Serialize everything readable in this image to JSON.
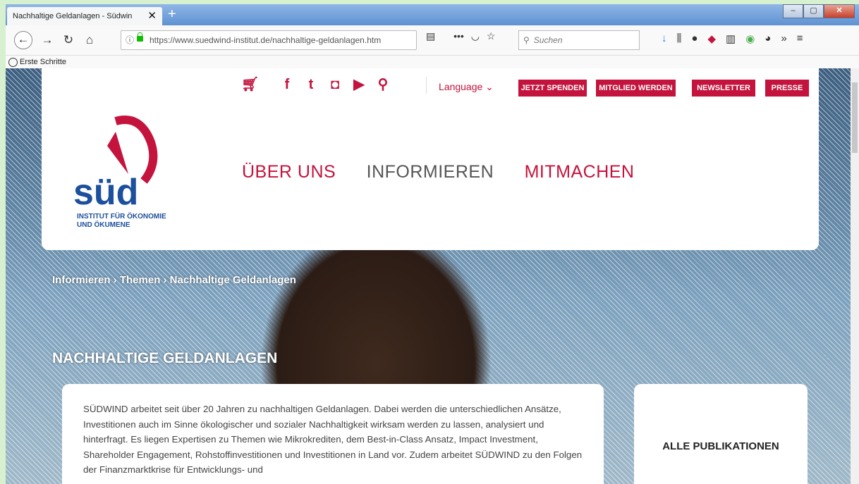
{
  "browser": {
    "tab_title": "Nachhaltige Geldanlagen - Südwin",
    "url_host": "https://www.suedwind-institut.de",
    "url_path": "/nachhaltige-geldanlagen.htm",
    "search_placeholder": "Suchen",
    "bookmark": "Erste Schritte"
  },
  "header": {
    "language": "Language ⌄",
    "buttons": [
      "JETZT SPENDEN",
      "MITGLIED WERDEN",
      "NEWSLETTER",
      "PRESSE"
    ],
    "logo_word": "süd",
    "logo_subtitle_1": "INSTITUT FÜR ÖKONOMIE",
    "logo_subtitle_2": "UND ÖKUMENE",
    "nav": [
      "ÜBER UNS",
      "INFORMIEREN",
      "MITMACHEN"
    ]
  },
  "breadcrumb": "Informieren  ›  Themen  ›  Nachhaltige Geldanlagen",
  "page_title": "NACHHALTIGE GELDANLAGEN",
  "content": "SÜDWIND arbeitet seit über 20 Jahren zu nachhaltigen Geldanlagen. Dabei werden die unterschiedlichen Ansätze, Investitionen auch im Sinne ökologischer und sozialer Nachhaltigkeit wirksam werden zu lassen, analysiert und hinterfragt. Es liegen Expertisen zu Themen wie Mikrokrediten, dem Best-in-Class Ansatz, Impact Investment, Shareholder Engagement, Rohstoffinvestitionen und Investitionen in Land vor. Zudem arbeitet SÜDWIND zu den Folgen der Finanzmarktkrise für Entwicklungs- und",
  "side_box": "ALLE PUBLIKATIONEN",
  "colors": {
    "accent": "#c4133c",
    "logo_blue": "#1c4f9c"
  }
}
